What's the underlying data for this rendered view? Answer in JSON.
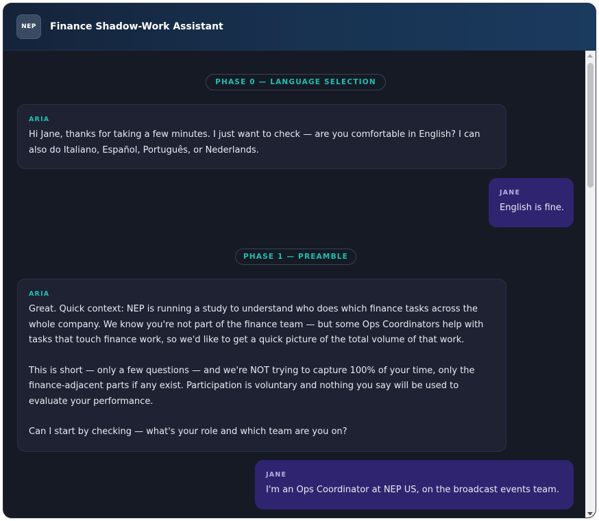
{
  "app": {
    "logo_text": "NEP",
    "title": "Finance Shadow-Work Assistant"
  },
  "messages": {
    "phase0": "PHASE 0 — LANGUAGE SELECTION",
    "aria1": {
      "sender": "ARIA",
      "text": "Hi Jane, thanks for taking a few minutes. I just want to check — are you comfortable in English? I can also do Italiano, Español, Português, or Nederlands."
    },
    "jane1": {
      "sender": "JANE",
      "text": "English is fine."
    },
    "phase1": "PHASE 1 — PREAMBLE",
    "aria2": {
      "sender": "ARIA",
      "p1": "Great. Quick context: NEP is running a study to understand who does which finance tasks across the whole company. We know you're not part of the finance team — but some Ops Coordinators help with tasks that touch finance work, so we'd like to get a quick picture of the total volume of that work.",
      "p2": "This is short — only a few questions — and we're NOT trying to capture 100% of your time, only the finance-adjacent parts if any exist. Participation is voluntary and nothing you say will be used to evaluate your performance.",
      "p3": "Can I start by checking — what's your role and which team are you on?"
    },
    "jane2": {
      "sender": "JANE",
      "text": "I'm an Ops Coordinator at NEP US, on the broadcast events team."
    }
  },
  "colors": {
    "accent": "#1fbfb3",
    "user_bubble": "#2f2470",
    "assistant_bubble": "#1f2233",
    "background": "#161a25"
  }
}
